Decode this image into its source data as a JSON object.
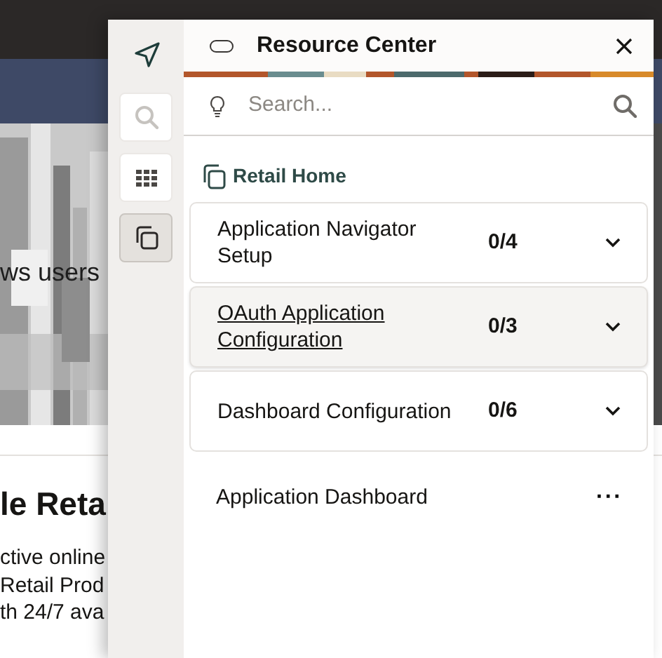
{
  "background": {
    "photo_caption": "ws users",
    "heading": "le Reta",
    "lines": [
      "ctive online",
      "Retail Prod",
      "th 24/7 ava"
    ]
  },
  "rail_buttons": [
    {
      "kind": "bare",
      "selected": false
    },
    {
      "kind": "tile",
      "selected": false
    },
    {
      "kind": "tile",
      "selected": false
    },
    {
      "kind": "tile",
      "selected": true
    }
  ],
  "panel": {
    "title": "Resource Center",
    "search": {
      "placeholder": "Search..."
    },
    "section": "Retail Home",
    "items": [
      {
        "kind": "checklist",
        "label": "Application Navigator Setup",
        "count": "0/4",
        "selected": false
      },
      {
        "kind": "checklist",
        "label": "OAuth Application Configuration",
        "count": "0/3",
        "selected": true
      },
      {
        "kind": "checklist",
        "label": "Dashboard Configuration",
        "count": "0/6",
        "selected": false
      },
      {
        "kind": "link",
        "label": "Application Dashboard",
        "more": "···"
      }
    ]
  }
}
